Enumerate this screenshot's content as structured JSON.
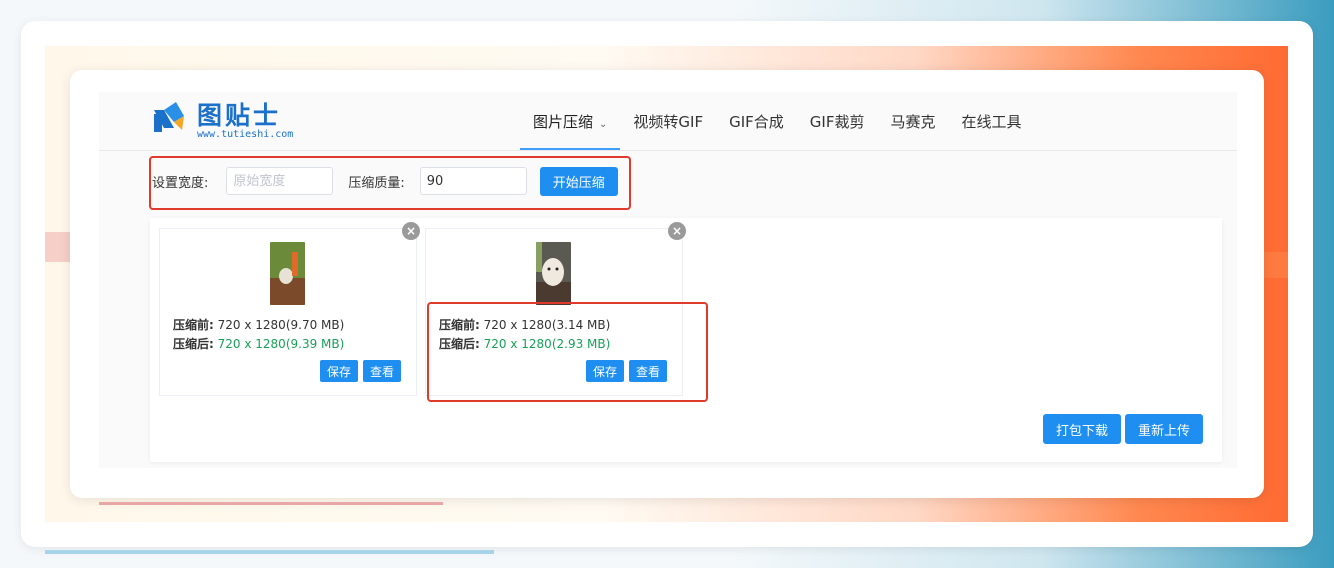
{
  "logo": {
    "name": "图贴士",
    "url": "www.tutieshi.com"
  },
  "nav": {
    "items": [
      {
        "label": "图片压缩",
        "active": true,
        "has_dropdown": true
      },
      {
        "label": "视频转GIF"
      },
      {
        "label": "GIF合成"
      },
      {
        "label": "GIF裁剪"
      },
      {
        "label": "马赛克"
      },
      {
        "label": "在线工具"
      }
    ]
  },
  "settings": {
    "width_label": "设置宽度:",
    "width_placeholder": "原始宽度",
    "width_value": "",
    "quality_label": "压缩质量:",
    "quality_value": "90",
    "start_button": "开始压缩"
  },
  "results": [
    {
      "before_label": "压缩前:",
      "before_value": "720 x 1280(9.70 MB)",
      "after_label": "压缩后:",
      "after_value": "720 x 1280(9.39 MB)",
      "save_label": "保存",
      "view_label": "查看",
      "close_icon": "close-icon"
    },
    {
      "before_label": "压缩前:",
      "before_value": "720 x 1280(3.14 MB)",
      "after_label": "压缩后:",
      "after_value": "720 x 1280(2.93 MB)",
      "save_label": "保存",
      "view_label": "查看",
      "close_icon": "close-icon"
    }
  ],
  "actions": {
    "download_all": "打包下载",
    "reupload": "重新上传"
  },
  "colors": {
    "accent_blue": "#1e8ff0",
    "green_value": "#18a058",
    "highlight_red": "#e03a2c",
    "logo_blue": "#1b70c9"
  }
}
